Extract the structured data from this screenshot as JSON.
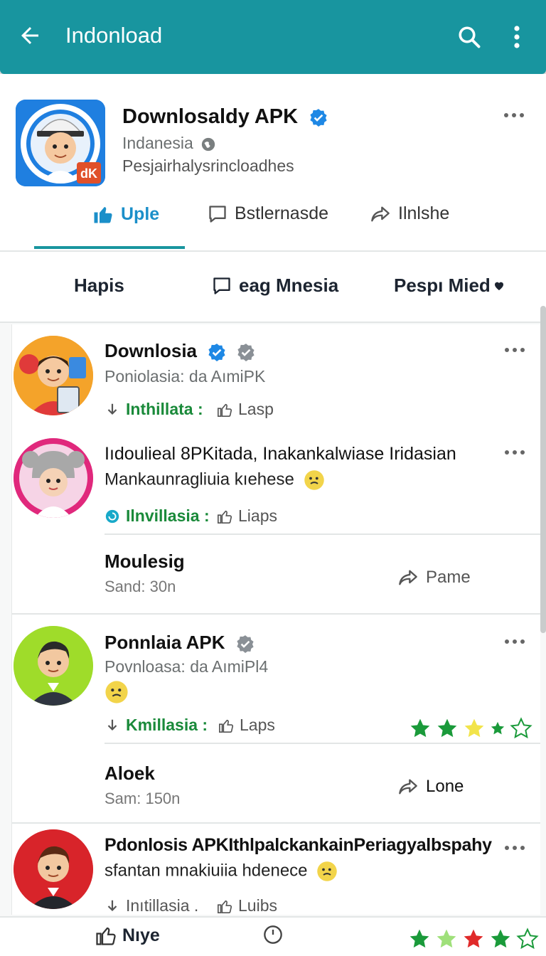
{
  "appbar": {
    "title": "Indonload",
    "back_icon": "arrow-left-icon",
    "search_icon": "search-icon",
    "menu_icon": "more-vertical-icon"
  },
  "profile": {
    "name": "Downlosaldy APK",
    "country": "Indanesia",
    "description": "Pesjairhalysrincloadhes",
    "tabs": [
      {
        "label": "Uple",
        "icon": "thumbs-up-icon",
        "active": true
      },
      {
        "label": "Bstlernasde",
        "icon": "comment-icon",
        "active": false
      },
      {
        "label": "Ilnlshe",
        "icon": "share-icon",
        "active": false
      }
    ]
  },
  "filters": [
    {
      "label": "Hapis"
    },
    {
      "label": "eag Mnesia",
      "icon": "comment-icon"
    },
    {
      "label": "Pespı Mied"
    }
  ],
  "posts": [
    {
      "name": "Downlosia",
      "subtitle": "Poniolasia: da AımiPK",
      "install_label": "Inthillata :",
      "like_label": "Lasp"
    },
    {
      "name": "Iıdoulieal 8PKitada, Inakankalwiase Iridasian",
      "text": "Mankaunragliuia kıehese",
      "install_label": "Ilnvillasia :",
      "like_label": "Liaps",
      "reply": {
        "title": "Moulesig",
        "meta": "Sand: 30n",
        "share_label": "Pame"
      }
    },
    {
      "name": "Ponnlaia APK",
      "subtitle": "Povnloasa: da AımiPl4",
      "install_label": "Kmillasia :",
      "like_label": "Laps",
      "reply": {
        "title": "Aloek",
        "meta": "Sam: 150n",
        "share_label": "Lone"
      }
    },
    {
      "name": "Pdonlosis APKIthlpalckankainPeriagyalbspahy",
      "text": "sfantan mnakiuiia hdenece",
      "install_label": "Inıtillasia .",
      "like_label": "Luibs"
    }
  ],
  "bottombar": {
    "like_label": "Nıye"
  },
  "colors": {
    "appbar": "#18959f",
    "accent": "#1b8fc9",
    "install_green": "#1a8a3a",
    "verified_blue": "#1e88e5"
  }
}
